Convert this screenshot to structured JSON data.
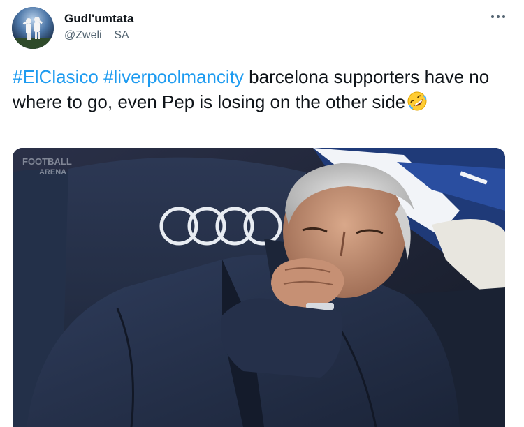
{
  "tweet": {
    "author": {
      "display_name": "Gudl'umtata",
      "handle": "@Zweli__SA"
    },
    "more_icon": "more-horizontal-icon",
    "text_parts": {
      "hashtag_1": "#ElClasico",
      "hashtag_2": "#liverpoolmancity",
      "body": " barcelona supporters have no where to go, even Pep  is losing on the other side",
      "emoji": "rolling-on-the-floor-laughing-emoji"
    },
    "media": {
      "watermark_line_1": "FOOTBALL",
      "watermark_line_2": "ARENA"
    }
  },
  "colors": {
    "hashtag": "#1d9bf0",
    "text": "#0f1419",
    "secondary_text": "#536471"
  }
}
